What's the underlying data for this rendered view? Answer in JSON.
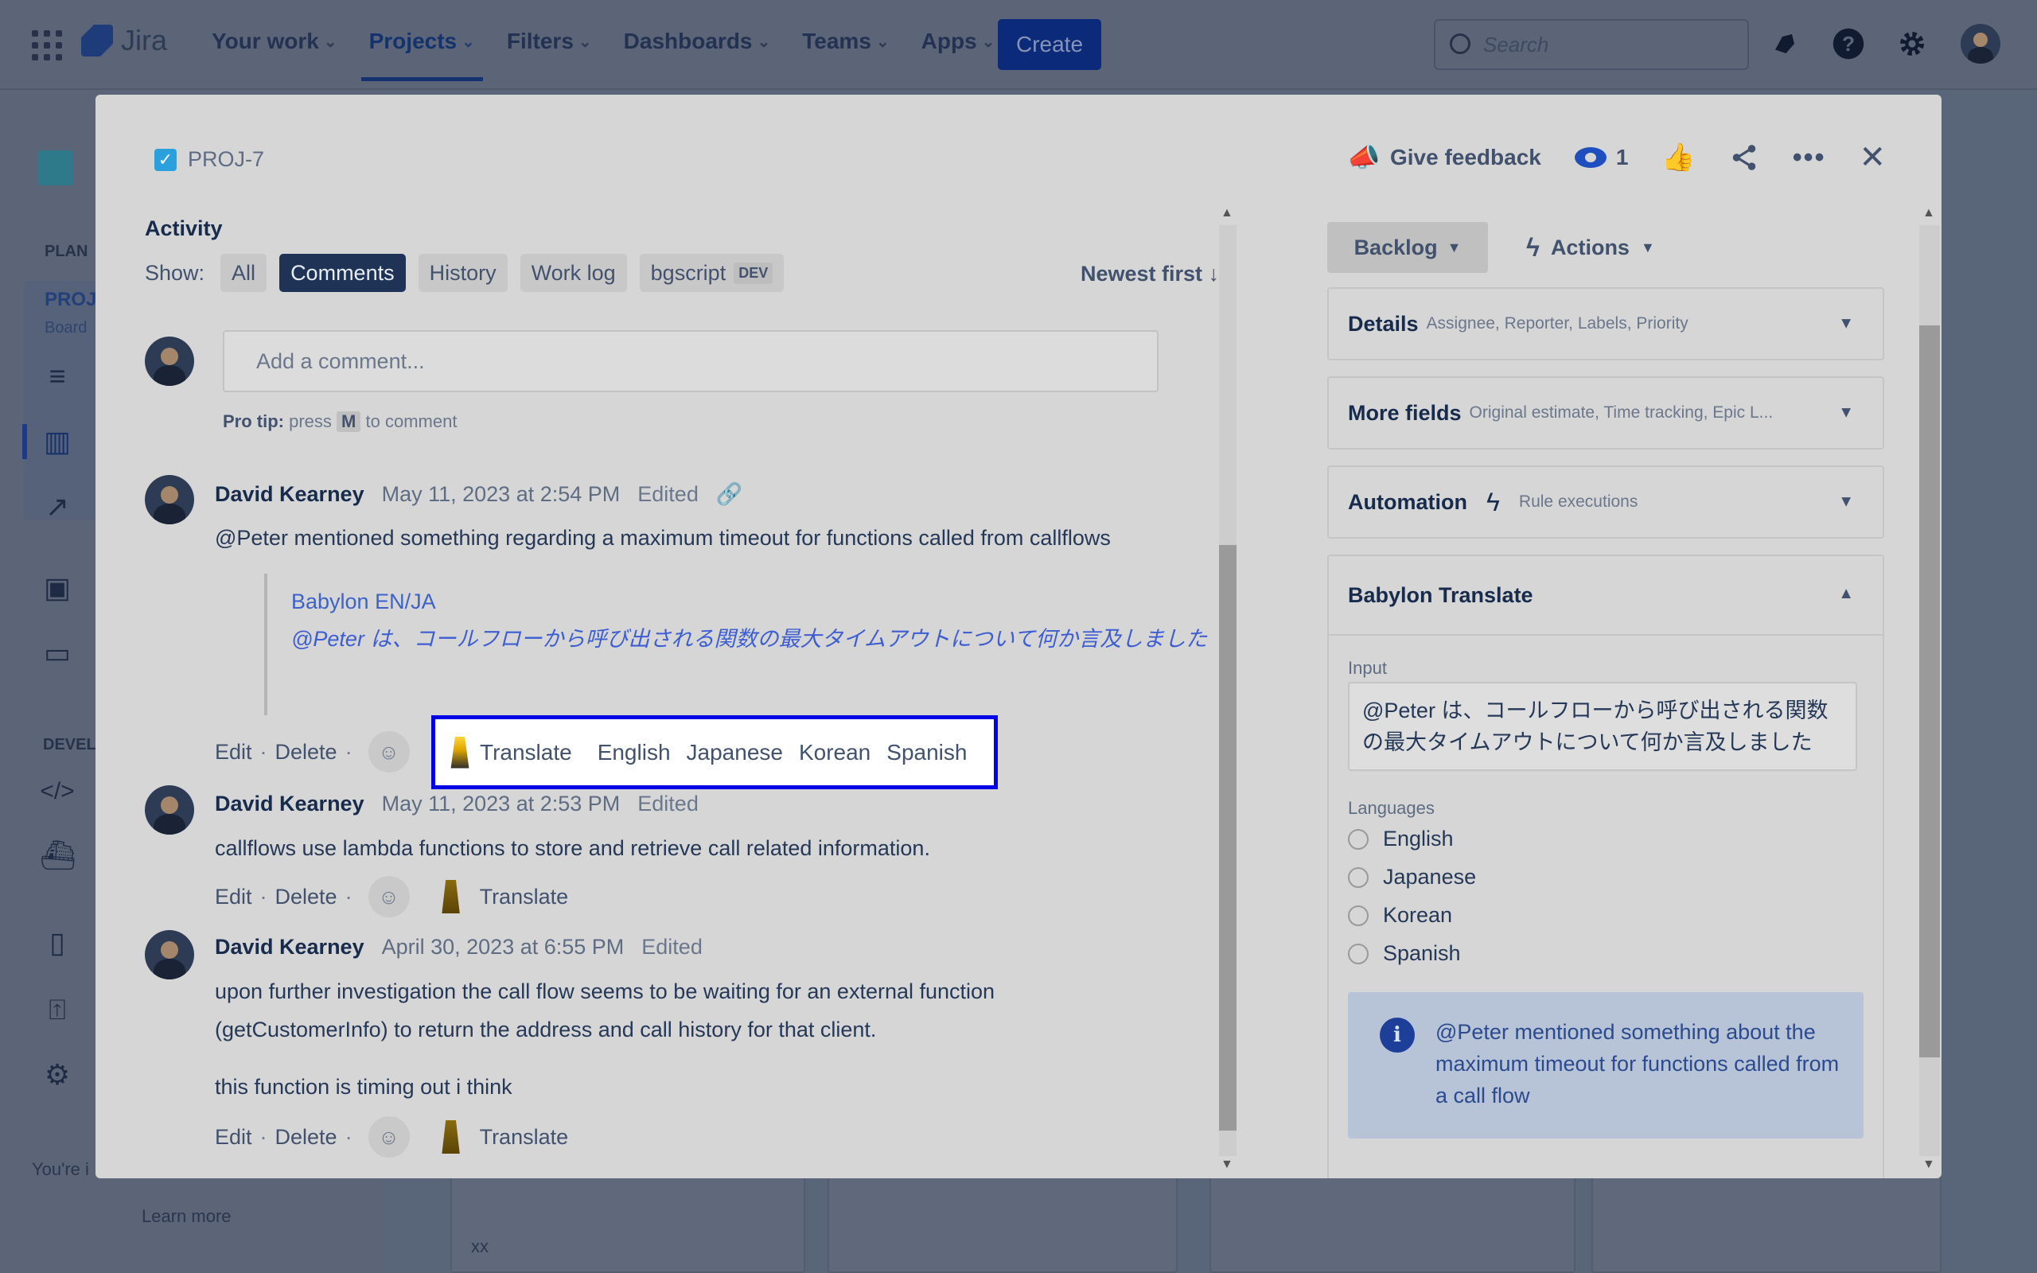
{
  "topbar": {
    "product": "Jira",
    "nav": [
      {
        "label": "Your work"
      },
      {
        "label": "Projects",
        "active": true
      },
      {
        "label": "Filters"
      },
      {
        "label": "Dashboards"
      },
      {
        "label": "Teams"
      },
      {
        "label": "Apps"
      }
    ],
    "create_label": "Create",
    "search_placeholder": "Search"
  },
  "leftnav": {
    "planning_label": "PLAN",
    "project_label": "PROJ",
    "project_sub": "Board",
    "dev_label": "DEVEL",
    "footer_text": "You're i",
    "learn_more": "Learn more"
  },
  "background": {
    "card_text": "xx"
  },
  "modal": {
    "issue_key": "PROJ-7",
    "give_feedback": "Give feedback",
    "watch_count": "1",
    "activity": {
      "title": "Activity",
      "show_label": "Show:",
      "filters": [
        "All",
        "Comments",
        "History",
        "Work log",
        "bgscript"
      ],
      "dev_badge": "DEV",
      "sort_label": "Newest first",
      "add_comment_placeholder": "Add a comment...",
      "protip_bold": "Pro tip:",
      "protip_press": "press",
      "protip_key": "M",
      "protip_rest": "to comment"
    },
    "comments": [
      {
        "author": "David Kearney",
        "time": "May 11, 2023 at 2:54 PM",
        "edited": "Edited",
        "body": "@Peter mentioned something regarding a maximum timeout for functions called from callflows",
        "quote_title": "Babylon EN/JA",
        "quote_body": "@Peter は、コールフローから呼び出される関数の最大タイムアウトについて何か言及しました"
      },
      {
        "author": "David Kearney",
        "time": "May 11, 2023 at 2:53 PM",
        "edited": "Edited",
        "body": "callflows use lambda functions to store and retrieve call related information."
      },
      {
        "author": "David Kearney",
        "time": "April 30, 2023 at 6:55 PM",
        "edited": "Edited",
        "body_line1": "upon further investigation the call flow seems to be waiting for an external function",
        "body_line2": "(getCustomerInfo) to return the address and call history for that client.",
        "body_line3": "this function is timing out i think"
      }
    ],
    "comment_actions": {
      "edit": "Edit",
      "delete": "Delete",
      "sep": "·",
      "translate": "Translate"
    },
    "translate_menu": {
      "translate": "Translate",
      "languages": [
        "English",
        "Japanese",
        "Korean",
        "Spanish"
      ]
    },
    "sidebar": {
      "status": "Backlog",
      "actions": "Actions",
      "details": {
        "title": "Details",
        "sub": "Assignee, Reporter, Labels, Priority"
      },
      "more_fields": {
        "title": "More fields",
        "sub": "Original estimate, Time tracking, Epic L..."
      },
      "automation": {
        "title": "Automation",
        "sub": "Rule executions"
      },
      "babylon": {
        "title": "Babylon Translate",
        "input_label": "Input",
        "input_value": "@Peter は、コールフローから呼び出される関数の最大タイムアウトについて何か言及しました",
        "languages_label": "Languages",
        "languages": [
          "English",
          "Japanese",
          "Korean",
          "Spanish"
        ],
        "info": "@Peter mentioned something about the maximum timeout for functions called from a call flow"
      }
    }
  }
}
